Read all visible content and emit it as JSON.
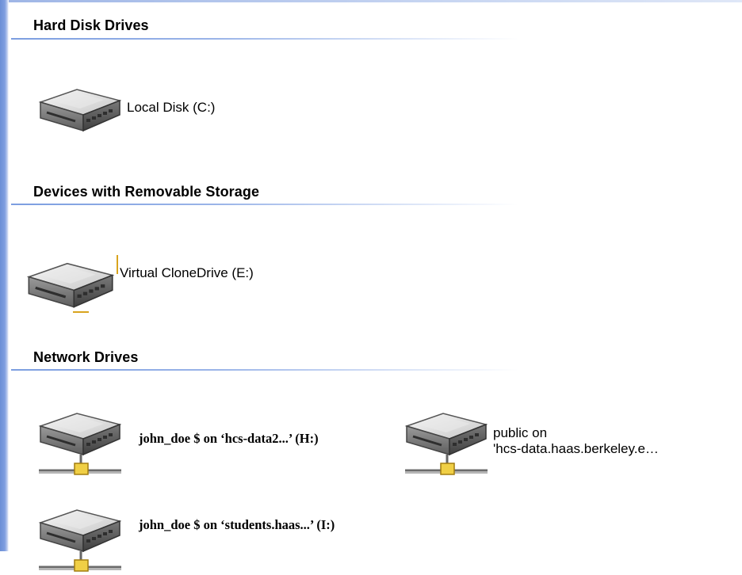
{
  "groups": {
    "hard_disk": {
      "title": "Hard Disk Drives",
      "items": [
        {
          "label": "Local Disk (C:)",
          "icon": "hard-disk-icon"
        }
      ]
    },
    "removable": {
      "title": "Devices with Removable Storage",
      "items": [
        {
          "label": "Virtual CloneDrive (E:)",
          "icon": "hard-disk-icon"
        }
      ]
    },
    "network": {
      "title": "Network Drives",
      "items": [
        {
          "label": "john_doe $ on ‘hcs-data2...’ (H:)",
          "icon": "network-drive-icon"
        },
        {
          "label_line1": "public on",
          "label_line2": "'hcs-data.haas.berkeley.e…",
          "icon": "network-drive-icon"
        },
        {
          "label": "john_doe $ on ‘students.haas...’ (I:)",
          "icon": "network-drive-icon"
        }
      ]
    }
  },
  "colors": {
    "rule": "#7c9ee0",
    "window_edge": "#6b8fd6",
    "connector": "#e8c43a"
  }
}
